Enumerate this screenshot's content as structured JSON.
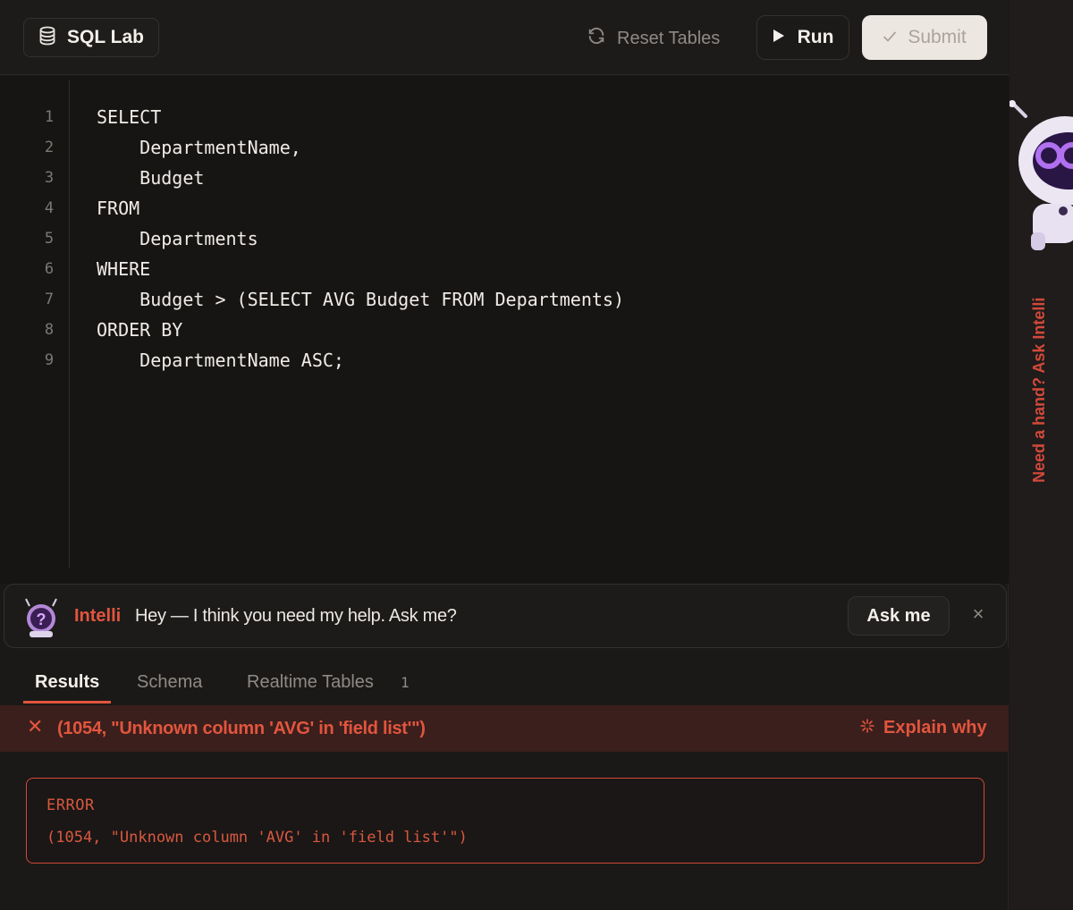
{
  "toolbar": {
    "brand_label": "SQL Lab",
    "reset_label": "Reset Tables",
    "run_label": "Run",
    "submit_label": "Submit"
  },
  "editor": {
    "lines": [
      {
        "num": "1",
        "code": "SELECT"
      },
      {
        "num": "2",
        "code": "    DepartmentName,"
      },
      {
        "num": "3",
        "code": "    Budget"
      },
      {
        "num": "4",
        "code": "FROM"
      },
      {
        "num": "5",
        "code": "    Departments"
      },
      {
        "num": "6",
        "code": "WHERE"
      },
      {
        "num": "7",
        "code": "    Budget > (SELECT AVG Budget FROM Departments)"
      },
      {
        "num": "8",
        "code": "ORDER BY"
      },
      {
        "num": "9",
        "code": "    DepartmentName ASC;"
      }
    ]
  },
  "banner": {
    "name": "Intelli",
    "message": "Hey — I think you need my help. Ask me?",
    "ask_label": "Ask me",
    "close_glyph": "×"
  },
  "tabs": {
    "results": "Results",
    "schema": "Schema",
    "realtime": "Realtime Tables",
    "realtime_count": "1"
  },
  "error_bar": {
    "text": "(1054, \"Unknown column 'AVG' in 'field list'\")",
    "explain_label": "Explain why"
  },
  "error_box": {
    "title": "ERROR",
    "message": "(1054, \"Unknown column 'AVG' in 'field list'\")"
  },
  "rail": {
    "label": "Need a hand? Ask Intelli"
  },
  "colors": {
    "accent": "#e2553e",
    "background": "#1b1918",
    "editor_bg": "#171514",
    "error_bg": "#3a1f1c"
  }
}
